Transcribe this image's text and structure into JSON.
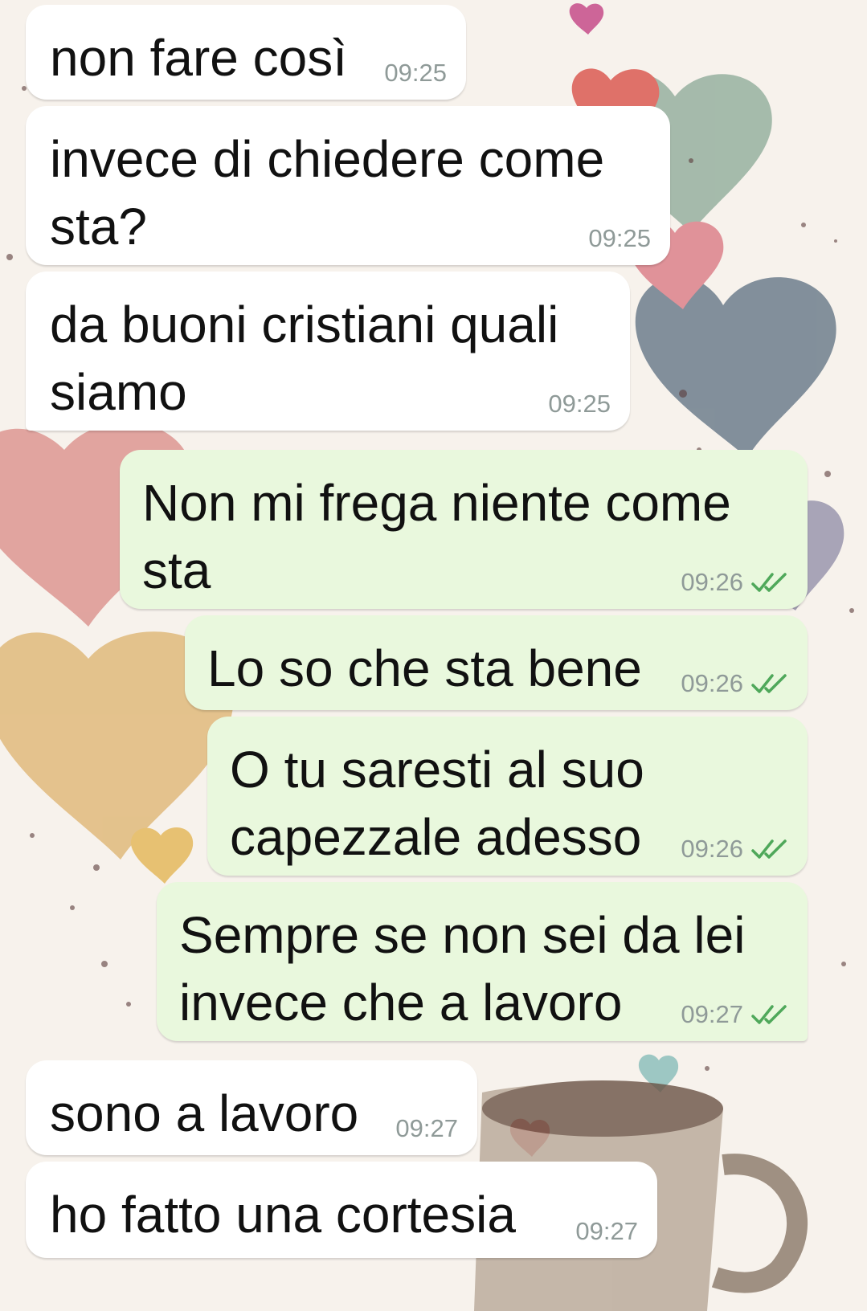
{
  "messages": [
    {
      "direction": "in",
      "text": "non fare così",
      "time": "09:25"
    },
    {
      "direction": "in",
      "text": "invece di chiedere come\nsta?",
      "time": "09:25"
    },
    {
      "direction": "in",
      "text": "da buoni cristiani quali\nsiamo",
      "time": "09:25"
    },
    {
      "direction": "out",
      "text": "Non mi frega niente come\nsta",
      "time": "09:26",
      "status_icon": "double-check-icon"
    },
    {
      "direction": "out",
      "text": "Lo so che sta bene",
      "time": "09:26",
      "status_icon": "double-check-icon"
    },
    {
      "direction": "out",
      "text": "O tu saresti al suo\ncapezzale adesso",
      "time": "09:26",
      "status_icon": "double-check-icon"
    },
    {
      "direction": "out",
      "text": "Sempre se non sei da lei\ninvece che a lavoro",
      "time": "09:27",
      "status_icon": "double-check-icon"
    },
    {
      "direction": "in",
      "text": "sono a lavoro",
      "time": "09:27"
    },
    {
      "direction": "in",
      "text": "ho fatto una cortesia",
      "time": "09:27"
    }
  ],
  "colors": {
    "incoming_bubble": "#ffffff",
    "outgoing_bubble": "#e9f8dd",
    "timestamp": "#8f9a98",
    "read_ticks": "#4fa85a"
  },
  "wallpaper": "watercolor hearts"
}
